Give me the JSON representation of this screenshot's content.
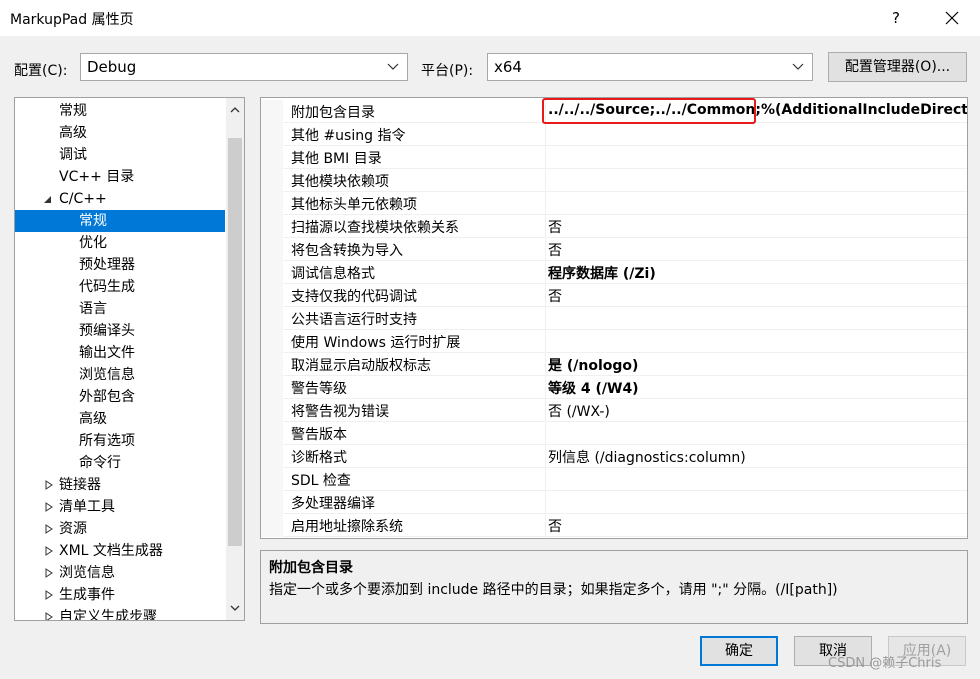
{
  "window": {
    "title": "MarkupPad 属性页",
    "help_label": "?"
  },
  "config": {
    "config_label": "配置(C):",
    "config_value": "Debug",
    "platform_label": "平台(P):",
    "platform_value": "x64",
    "manager_button": "配置管理器(O)..."
  },
  "tree": {
    "items": [
      {
        "label": "常规"
      },
      {
        "label": "高级"
      },
      {
        "label": "调试"
      },
      {
        "label": "VC++ 目录"
      },
      {
        "label": "C/C++"
      },
      {
        "label": "常规"
      },
      {
        "label": "优化"
      },
      {
        "label": "预处理器"
      },
      {
        "label": "代码生成"
      },
      {
        "label": "语言"
      },
      {
        "label": "预编译头"
      },
      {
        "label": "输出文件"
      },
      {
        "label": "浏览信息"
      },
      {
        "label": "外部包含"
      },
      {
        "label": "高级"
      },
      {
        "label": "所有选项"
      },
      {
        "label": "命令行"
      },
      {
        "label": "链接器"
      },
      {
        "label": "清单工具"
      },
      {
        "label": "资源"
      },
      {
        "label": "XML 文档生成器"
      },
      {
        "label": "浏览信息"
      },
      {
        "label": "生成事件"
      },
      {
        "label": "自定义生成步骤"
      }
    ]
  },
  "grid": {
    "rows": [
      {
        "name": "附加包含目录",
        "value": "../../../Source;../../Common;%(AdditionalIncludeDirector"
      },
      {
        "name": "其他 #using 指令",
        "value": ""
      },
      {
        "name": "其他 BMI 目录",
        "value": ""
      },
      {
        "name": "其他模块依赖项",
        "value": ""
      },
      {
        "name": "其他标头单元依赖项",
        "value": ""
      },
      {
        "name": "扫描源以查找模块依赖关系",
        "value": "否"
      },
      {
        "name": "将包含转换为导入",
        "value": "否"
      },
      {
        "name": "调试信息格式",
        "value": "程序数据库 (/Zi)"
      },
      {
        "name": "支持仅我的代码调试",
        "value": "否"
      },
      {
        "name": "公共语言运行时支持",
        "value": ""
      },
      {
        "name": "使用 Windows 运行时扩展",
        "value": ""
      },
      {
        "name": "取消显示启动版权标志",
        "value": "是 (/nologo)"
      },
      {
        "name": "警告等级",
        "value": "等级 4 (/W4)"
      },
      {
        "name": "将警告视为错误",
        "value": "否 (/WX-)"
      },
      {
        "name": "警告版本",
        "value": ""
      },
      {
        "name": "诊断格式",
        "value": "列信息 (/diagnostics:column)"
      },
      {
        "name": "SDL 检查",
        "value": ""
      },
      {
        "name": "多处理器编译",
        "value": ""
      },
      {
        "name": "启用地址擦除系统",
        "value": "否"
      }
    ]
  },
  "description": {
    "title": "附加包含目录",
    "text": "指定一个或多个要添加到 include 路径中的目录；如果指定多个，请用 \";\" 分隔。(/I[path])"
  },
  "buttons": {
    "ok": "确定",
    "cancel": "取消",
    "apply": "应用(A)"
  },
  "watermark": "CSDN @赖子Chris",
  "colors": {
    "selection": "#0078d7",
    "highlight_box": "#e81919"
  }
}
